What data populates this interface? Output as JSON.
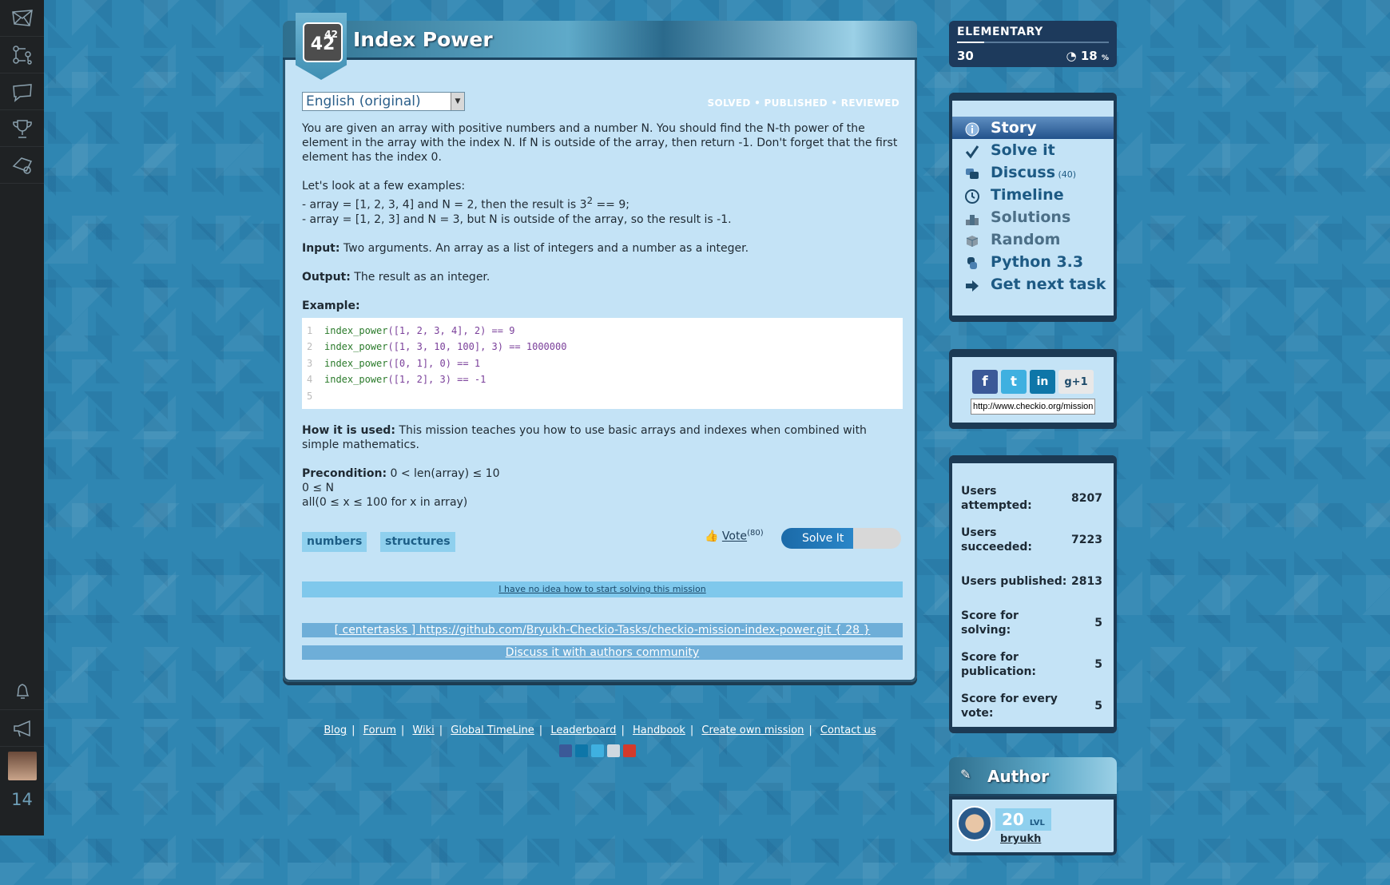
{
  "rail": {
    "count": "14"
  },
  "mission": {
    "number": "42",
    "number_sup": "42",
    "title": "Index Power",
    "language": "English (original)",
    "status": "SOLVED • PUBLISHED • REVIEWED",
    "p1": "You are given an array with positive numbers and a number N. You should find the N-th power of the element in the array with the index N. If N is outside of the array, then return -1. Don't forget that the first element has the index 0.",
    "examples_intro": "Let's look at a few examples:",
    "example_a_pre": "- array = [1, 2, 3, 4] and N = 2, then the result is 3",
    "example_a_sup": "2",
    "example_a_post": " == 9;",
    "example_b": "- array = [1, 2, 3] and N = 3, but N is outside of the array, so the result is -1.",
    "input_label": "Input:",
    "input_text": " Two arguments. An array as a list of integers and a number as a integer.",
    "output_label": "Output:",
    "output_text": " The result as an integer.",
    "example_label": "Example:",
    "code": [
      {
        "ln": "1",
        "fn": "index_power",
        "args": "([1, 2, 3, 4], 2) == 9"
      },
      {
        "ln": "2",
        "fn": "index_power",
        "args": "([1, 3, 10, 100], 3) == 1000000"
      },
      {
        "ln": "3",
        "fn": "index_power",
        "args": "([0, 1], 0) == 1"
      },
      {
        "ln": "4",
        "fn": "index_power",
        "args": "([1, 2], 3) == -1"
      },
      {
        "ln": "5",
        "fn": "",
        "args": ""
      }
    ],
    "how_label": "How it is used:",
    "how_text": " This mission teaches you how to use basic arrays and indexes when combined with simple mathematics.",
    "pre_label": "Precondition:",
    "pre_1": " 0 < len(array) ≤ 10",
    "pre_2": "0 ≤ N",
    "pre_3": "all(0 ≤ x ≤ 100 for x in array)",
    "tags": [
      "numbers",
      "structures"
    ],
    "vote_label": "Vote",
    "vote_count": "(80)",
    "solve_button": "Solve It",
    "hint_link": "I have no idea how to start solving this mission",
    "repo_link": "[ centertasks ] https://github.com/Bryukh-Checkio-Tasks/checkio-mission-index-power.git { 28 }",
    "discuss_link": "Discuss it with authors community"
  },
  "level": {
    "name": "ELEMENTARY",
    "value": "30",
    "percent": "18",
    "percent_unit": "%",
    "progress_fraction": 0.18
  },
  "menu": [
    {
      "label": "Story",
      "extra": ""
    },
    {
      "label": "Solve it",
      "extra": ""
    },
    {
      "label": "Discuss",
      "extra": " (40)"
    },
    {
      "label": "Timeline",
      "extra": ""
    },
    {
      "label": "Solutions",
      "extra": ""
    },
    {
      "label": "Random",
      "extra": ""
    },
    {
      "label": "Python 3.3",
      "extra": ""
    },
    {
      "label": "Get next task",
      "extra": ""
    }
  ],
  "share": {
    "url": "http://www.checkio.org/mission/index-power/",
    "gplus": "+1"
  },
  "stats": [
    {
      "label": "Users attempted:",
      "value": "8207"
    },
    {
      "label": "Users succeeded:",
      "value": "7223"
    },
    {
      "label": "Users published:",
      "value": "2813"
    },
    {
      "label": "Score for solving:",
      "value": "5"
    },
    {
      "label": "Score for publication:",
      "value": "5"
    },
    {
      "label": "Score for every vote:",
      "value": "5"
    }
  ],
  "author": {
    "heading": "Author",
    "level": "20",
    "level_unit": "LVL",
    "name": "bryukh"
  },
  "footer": [
    "Blog",
    "Forum",
    "Wiki",
    "Global TimeLine",
    "Leaderboard",
    "Handbook",
    "Create own mission",
    "Contact us"
  ],
  "colors": {
    "accent": "#2a86c8",
    "panel": "#c4e3f6",
    "dark": "#1c3a54"
  }
}
